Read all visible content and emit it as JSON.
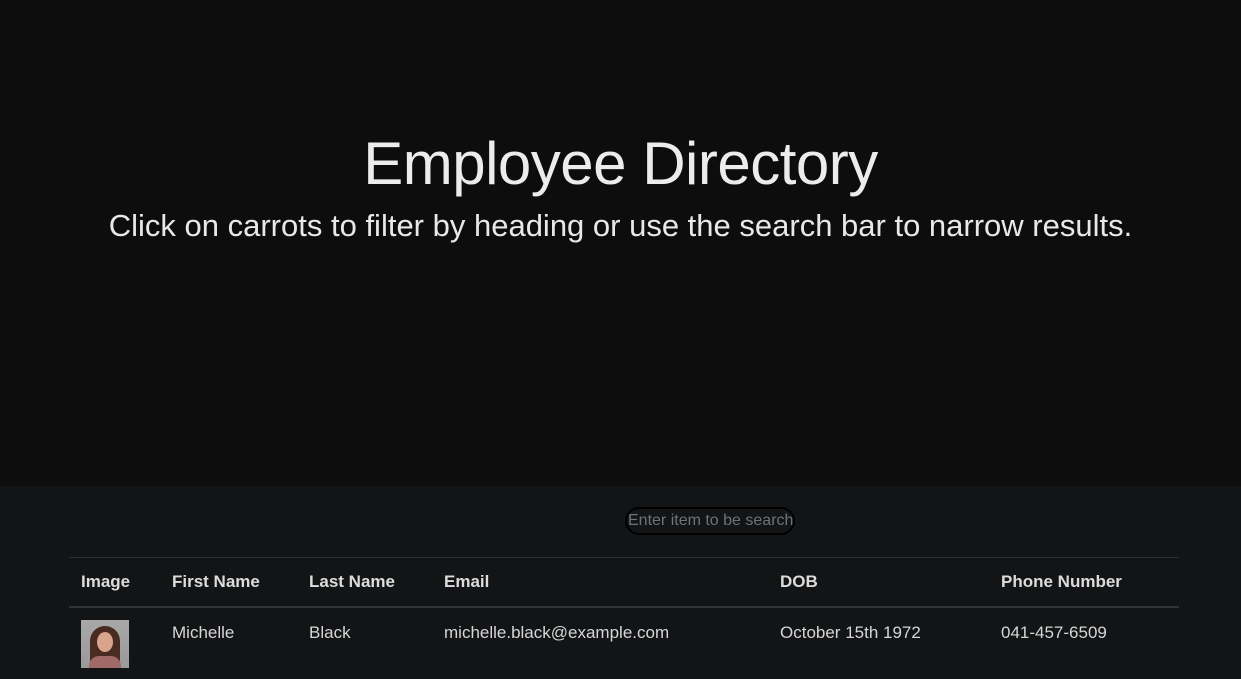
{
  "header": {
    "title": "Employee Directory",
    "subtitle": "Click on carrots to filter by heading or use the search bar to narrow results."
  },
  "search": {
    "placeholder": "Enter item to be searched",
    "value": ""
  },
  "table": {
    "headers": [
      "Image",
      "First Name",
      "Last Name",
      "Email",
      "DOB",
      "Phone Number"
    ],
    "rows": [
      {
        "image": "avatar-photo",
        "first_name": "Michelle",
        "last_name": "Black",
        "email": "michelle.black@example.com",
        "dob": "October 15th 1972",
        "phone": "041-457-6509"
      }
    ]
  }
}
